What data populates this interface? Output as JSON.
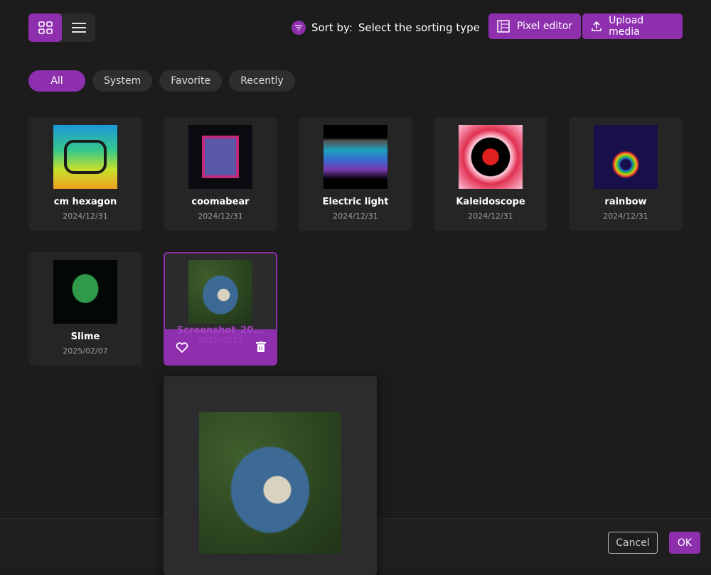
{
  "toolbar": {
    "sort_label": "Sort by:",
    "sort_value": "Select the sorting type",
    "pixel_editor": "Pixel editor",
    "upload_media": "Upload media"
  },
  "filters": [
    "All",
    "System",
    "Favorite",
    "Recently"
  ],
  "items": [
    {
      "name": "cm hexagon",
      "date": "2024/12/31"
    },
    {
      "name": "coomabear",
      "date": "2024/12/31"
    },
    {
      "name": "Electric light",
      "date": "2024/12/31"
    },
    {
      "name": "Kaleidoscope",
      "date": "2024/12/31"
    },
    {
      "name": "rainbow",
      "date": "2024/12/31"
    },
    {
      "name": "Slime",
      "date": "2025/02/07"
    },
    {
      "name": "Screenshot_20...",
      "date": "2025/02/12"
    }
  ],
  "footer": {
    "cancel": "Cancel",
    "ok": "OK"
  },
  "colors": {
    "accent": "#8e2fae",
    "bg": "#1c1c1c"
  }
}
